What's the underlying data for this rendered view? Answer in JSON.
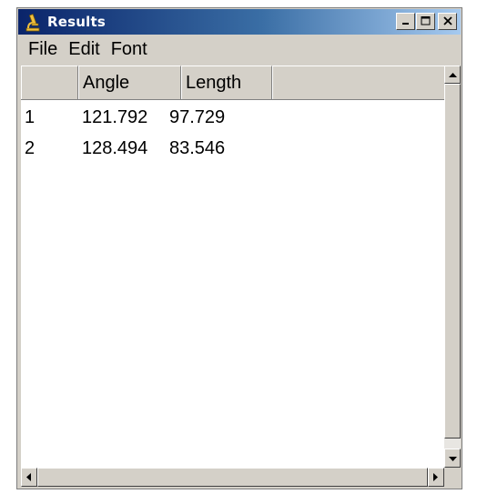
{
  "window": {
    "title": "Results",
    "app_icon": "microscope-icon",
    "controls": [
      "minimize-icon",
      "maximize-icon",
      "close-icon"
    ]
  },
  "menu": {
    "items": [
      "File",
      "Edit",
      "Font"
    ]
  },
  "table": {
    "columns": [
      "",
      "Angle",
      "Length",
      ""
    ],
    "rows": [
      [
        "1",
        "121.792",
        "97.729"
      ],
      [
        "2",
        "128.494",
        "83.546"
      ]
    ]
  },
  "colors": {
    "titlebar_start": "#0a246a",
    "titlebar_end": "#a6caf0",
    "chrome": "#d4d0c8"
  }
}
